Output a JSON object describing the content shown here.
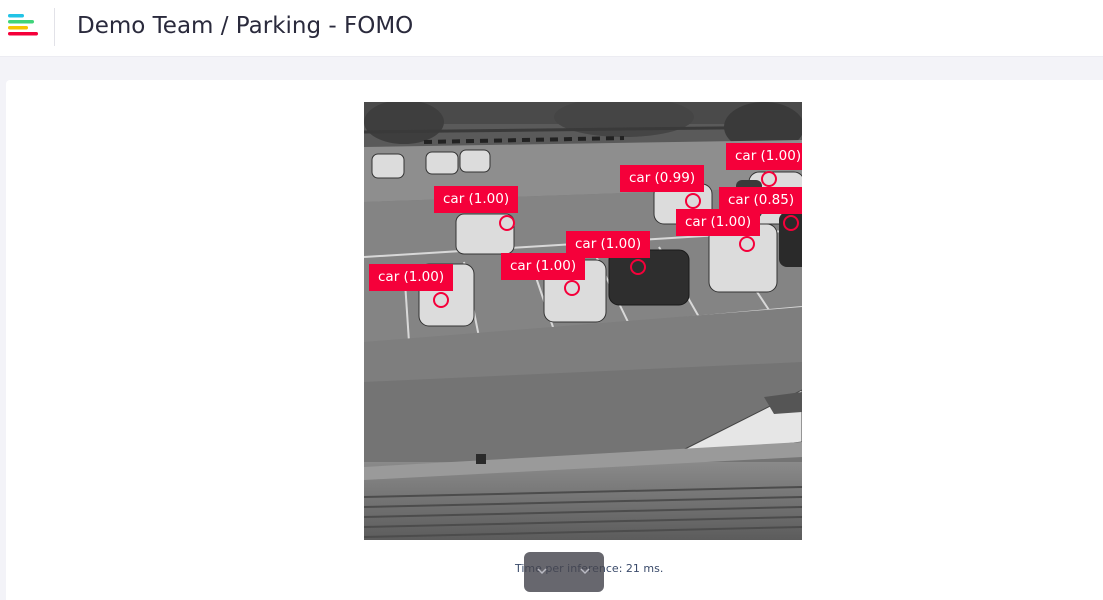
{
  "header": {
    "title": "Demo Team / Parking - FOMO",
    "logo_colors": [
      "#22c3e6",
      "#3fd47a",
      "#f5c400",
      "#f5003a"
    ]
  },
  "camera": {
    "detection_color": "#f5003a",
    "detections": [
      {
        "label": "car (1.00)"
      },
      {
        "label": "car (0.99)"
      },
      {
        "label": "car (1.00)"
      },
      {
        "label": "car (0.85)"
      },
      {
        "label": "car (1.00)"
      },
      {
        "label": "car (1.00)"
      },
      {
        "label": "car (1.00)"
      },
      {
        "label": "car (1.00)"
      }
    ]
  },
  "footer": {
    "inference_text": "Time per inference: 21 ms."
  }
}
